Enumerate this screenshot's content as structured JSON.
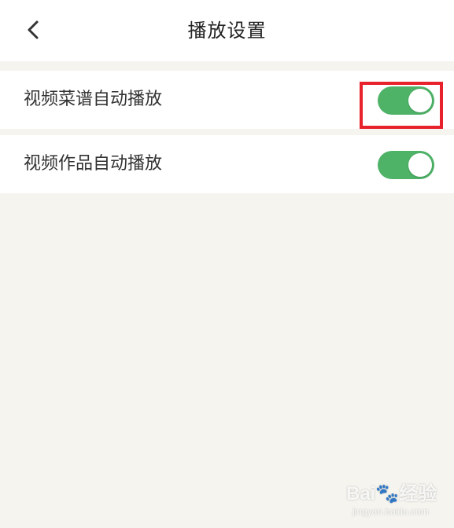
{
  "header": {
    "title": "播放设置",
    "back_icon": "chevron-left-icon"
  },
  "settings": [
    {
      "label": "视频菜谱自动播放",
      "enabled": true
    },
    {
      "label": "视频作品自动播放",
      "enabled": true
    }
  ],
  "colors": {
    "toggle_on": "#4eb267",
    "highlight": "#e8222a",
    "background": "#f5f4ef"
  },
  "watermark": {
    "brand": "Bai🐾经验",
    "url": "jingyan.baidu.com"
  }
}
